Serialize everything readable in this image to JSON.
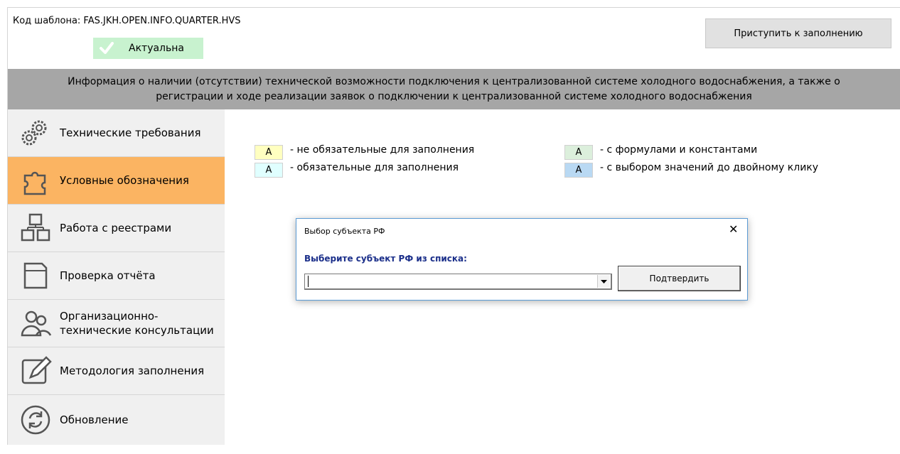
{
  "header": {
    "template_code": "Код шаблона: FAS.JKH.OPEN.INFO.QUARTER.HVS",
    "status_label": "Актуальна",
    "start_button_label": "Приступить к заполнению"
  },
  "banner": {
    "line1": "Информация о наличии (отсутствии) технической возможности подключения к централизованной системе холодного водоснабжения, а также о",
    "line2": "регистрации и ходе реализации заявок о подключении к централизованной системе холодного водоснабжения"
  },
  "sidebar": {
    "items": [
      {
        "label": "Технические требования",
        "icon": "gears-icon"
      },
      {
        "label": "Условные обозначения",
        "icon": "puzzle-icon",
        "active": true
      },
      {
        "label": "Работа с реестрами",
        "icon": "registry-icon"
      },
      {
        "label": "Проверка отчёта",
        "icon": "document-icon"
      },
      {
        "label_line1": "Организационно-",
        "label_line2": "технические консультации",
        "icon": "people-icon"
      },
      {
        "label": "Методология заполнения",
        "icon": "edit-icon"
      },
      {
        "label": "Обновление",
        "icon": "refresh-icon"
      }
    ]
  },
  "legend": {
    "swatch_letter": "A",
    "items": [
      {
        "text": "- не обязательные для заполнения",
        "color": "#ffffc0"
      },
      {
        "text": "- обязательные для заполнения",
        "color": "#e0ffff"
      },
      {
        "text": "- с формулами и константами",
        "color": "#dcefdc"
      },
      {
        "text": "- с выбором значений до двойному клику",
        "color": "#b9d9f3"
      }
    ]
  },
  "dialog": {
    "title": "Выбор субъекта РФ",
    "close_glyph": "✕",
    "prompt": "Выберите субъект РФ из списка:",
    "combo_value": "",
    "confirm_label": "Подтвердить"
  },
  "colors": {
    "status_bg": "#c8f2cf",
    "banner_bg": "#a6a6a6",
    "active_item_bg": "#fbb462",
    "dialog_border": "#5b9bd5"
  }
}
